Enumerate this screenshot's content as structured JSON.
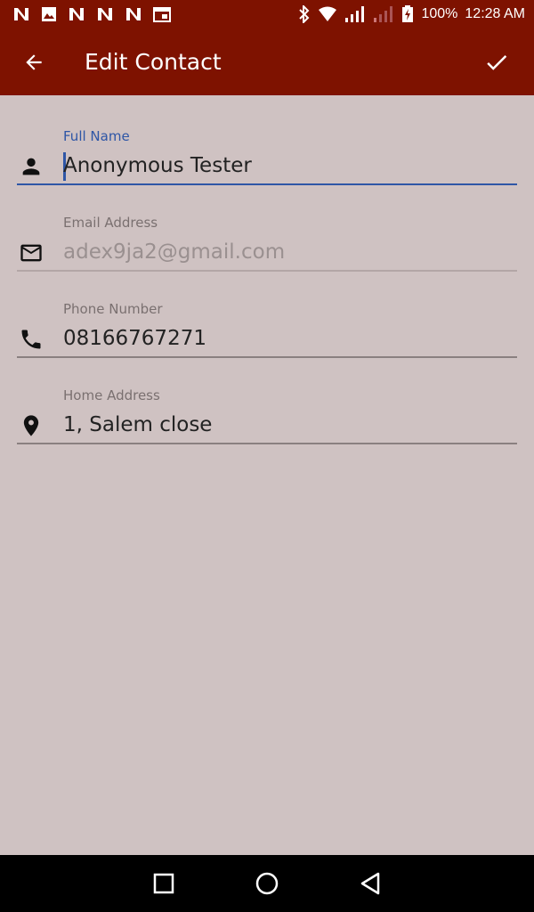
{
  "status_bar": {
    "battery": "100%",
    "time": "12:28 AM",
    "left_icons": [
      "notification-n-icon",
      "image-icon",
      "notification-n-icon",
      "notification-n-icon",
      "notification-n-icon",
      "calendar-icon"
    ],
    "right_icons": [
      "bluetooth-icon",
      "wifi-icon",
      "signal-icon",
      "signal-weak-icon",
      "battery-charging-icon"
    ]
  },
  "app_bar": {
    "title": "Edit Contact",
    "back_icon": "arrow-back-icon",
    "save_icon": "check-icon",
    "background": "#7e1200"
  },
  "fields": [
    {
      "label": "Full Name",
      "value": "Anonymous Tester",
      "icon": "person-icon",
      "focused": true
    },
    {
      "label": "Email Address",
      "value": "",
      "placeholder": "adex9ja2@gmail.com",
      "icon": "mail-icon",
      "focused": false
    },
    {
      "label": "Phone Number",
      "value": "08166767271",
      "icon": "phone-icon",
      "focused": false
    },
    {
      "label": "Home Address",
      "value": "1, Salem close",
      "icon": "location-pin-icon",
      "focused": false
    }
  ],
  "nav_bar": {
    "recent_icon": "square-icon",
    "home_icon": "circle-icon",
    "back_icon": "triangle-back-icon"
  },
  "colors": {
    "accent": "#2e56a6",
    "background": "#cfc2c2",
    "primary": "#7e1200"
  }
}
